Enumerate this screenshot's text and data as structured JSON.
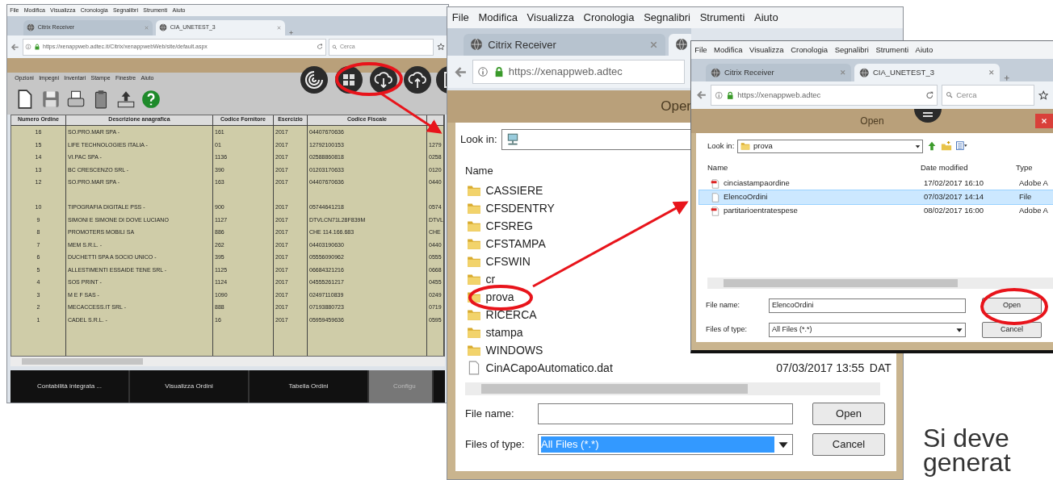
{
  "left_window": {
    "menu": [
      "File",
      "Modifica",
      "Visualizza",
      "Cronologia",
      "Segnalibri",
      "Strumenti",
      "Aiuto"
    ],
    "tabs": [
      {
        "label": "Citrix Receiver",
        "selected": false
      },
      {
        "label": "CIA_UNETEST_3",
        "selected": true
      }
    ],
    "url": "https://xenappweb.adtec.it/Citrix/xenappwebWeb/site/default.aspx",
    "search_placeholder": "Cerca",
    "app_menu": [
      "Opzioni",
      "Impegni",
      "Inventari",
      "Stampe",
      "Finestre",
      "Aiuto"
    ],
    "table": {
      "columns": [
        "Numero Ordine",
        "Descrizione anagrafica",
        "Codice Fornitore",
        "Esercizio",
        "Codice Fiscale"
      ],
      "rows": [
        [
          "16",
          "SO.PRO.MAR SPA -",
          "161",
          "2017",
          "04407670636"
        ],
        [
          "15",
          "LIFE TECHNOLOGIES ITALIA -",
          "01",
          "2017",
          "12792100153",
          "1279"
        ],
        [
          "14",
          "VI.PAC SPA -",
          "1136",
          "2017",
          "02588860818",
          "0258"
        ],
        [
          "13",
          "BC CRESCENZO SRL -",
          "390",
          "2017",
          "01203170633",
          "0120"
        ],
        [
          "12",
          "SO.PRO.MAR SPA -",
          "163",
          "2017",
          "04407670636",
          "0440"
        ],
        [
          "10",
          "TIPOGRAFIA DIGITALE PSS -",
          "900",
          "2017",
          "05744641218",
          "0574"
        ],
        [
          "9",
          "SIMONI E SIMONE DI DOVE LUCIANO",
          "1127",
          "2017",
          "DTVLCN71L28F839M",
          "DTVL"
        ],
        [
          "8",
          "PROMOTERS MOBILI SA",
          "886",
          "2017",
          "CHE 114.166.683",
          "CHE"
        ],
        [
          "7",
          "MEM S.R.L. -",
          "262",
          "2017",
          "04403190630",
          "0440"
        ],
        [
          "6",
          "DUCHETTI SPA A SOCIO UNICO -",
          "395",
          "2017",
          "05556090962",
          "0555"
        ],
        [
          "5",
          "ALLESTIMENTI ESSAIDE TENE SRL -",
          "1125",
          "2017",
          "06684321216",
          "0668"
        ],
        [
          "4",
          "SOS PRINT -",
          "1124",
          "2017",
          "04555261217",
          "0455"
        ],
        [
          "3",
          "M E F SAS -",
          "1090",
          "2017",
          "02497110839",
          "0249"
        ],
        [
          "2",
          "MECACCESS.IT SRL -",
          "888",
          "2017",
          "07193880723",
          "0719"
        ],
        [
          "1",
          "CADEL S.R.L. -",
          "16",
          "2017",
          "05959459636",
          "0595"
        ]
      ]
    },
    "bottom_tabs": [
      {
        "label": "Contabilità integrata ...",
        "selected": false
      },
      {
        "label": "Visualizza Ordini",
        "selected": false
      },
      {
        "label": "Tabella Ordini",
        "selected": false
      },
      {
        "label": "Configu",
        "selected": true
      }
    ]
  },
  "middle_window": {
    "menu": [
      "File",
      "Modifica",
      "Visualizza",
      "Cronologia",
      "Segnalibri",
      "Strumenti",
      "Aiuto"
    ],
    "tabs": [
      {
        "label": "Citrix Receiver",
        "selected": false
      },
      {
        "selected": true
      }
    ],
    "url": "https://xenappweb.adtec",
    "dialog": {
      "title": "Oper",
      "look_in_label": "Look in:",
      "name_header": "Name",
      "items": [
        {
          "kind": "folder",
          "name": "CASSIERE"
        },
        {
          "kind": "folder",
          "name": "CFSDENTRY"
        },
        {
          "kind": "folder",
          "name": "CFSREG"
        },
        {
          "kind": "folder",
          "name": "CFSTAMPA"
        },
        {
          "kind": "folder",
          "name": "CFSWIN"
        },
        {
          "kind": "folder",
          "name": "cr"
        },
        {
          "kind": "folder",
          "name": "prova"
        },
        {
          "kind": "folder",
          "name": "RICERCA"
        },
        {
          "kind": "folder",
          "name": "stampa"
        },
        {
          "kind": "folder",
          "name": "WINDOWS"
        },
        {
          "kind": "file",
          "name": "CinACapoAutomatico.dat",
          "date": "07/03/2017 13:55",
          "type": "DAT"
        }
      ],
      "file_name_label": "File name:",
      "file_type_label": "Files of type:",
      "file_type_value": "All Files (*.*)",
      "open_button": "Open",
      "cancel_button": "Cancel"
    }
  },
  "right_window": {
    "menu": [
      "File",
      "Modifica",
      "Visualizza",
      "Cronologia",
      "Segnalibri",
      "Strumenti",
      "Aiuto"
    ],
    "tabs": [
      {
        "label": "Citrix Receiver",
        "selected": false
      },
      {
        "label": "CIA_UNETEST_3",
        "selected": true
      }
    ],
    "url": "https://xenappweb.adtec",
    "search_placeholder": "Cerca",
    "dialog": {
      "title": "Open",
      "look_in_label": "Look in:",
      "look_in_value": "prova",
      "columns": [
        "Name",
        "Date modified",
        "Type"
      ],
      "items": [
        {
          "kind": "pdf",
          "name": "cinciastampaordine",
          "date": "17/02/2017 16:10",
          "type": "Adobe A",
          "selected": false
        },
        {
          "kind": "file",
          "name": "ElencoOrdini",
          "date": "07/03/2017 14:14",
          "type": "File",
          "selected": true
        },
        {
          "kind": "pdf",
          "name": "partitarioentratespese",
          "date": "08/02/2017 16:00",
          "type": "Adobe A",
          "selected": false
        }
      ],
      "file_name_label": "File name:",
      "file_name_value": "ElencoOrdini",
      "file_type_label": "Files of type:",
      "file_type_value": "All Files (*.*)",
      "open_button": "Open",
      "cancel_button": "Cancel"
    }
  },
  "slide_text": [
    "Si deve",
    "generat"
  ]
}
